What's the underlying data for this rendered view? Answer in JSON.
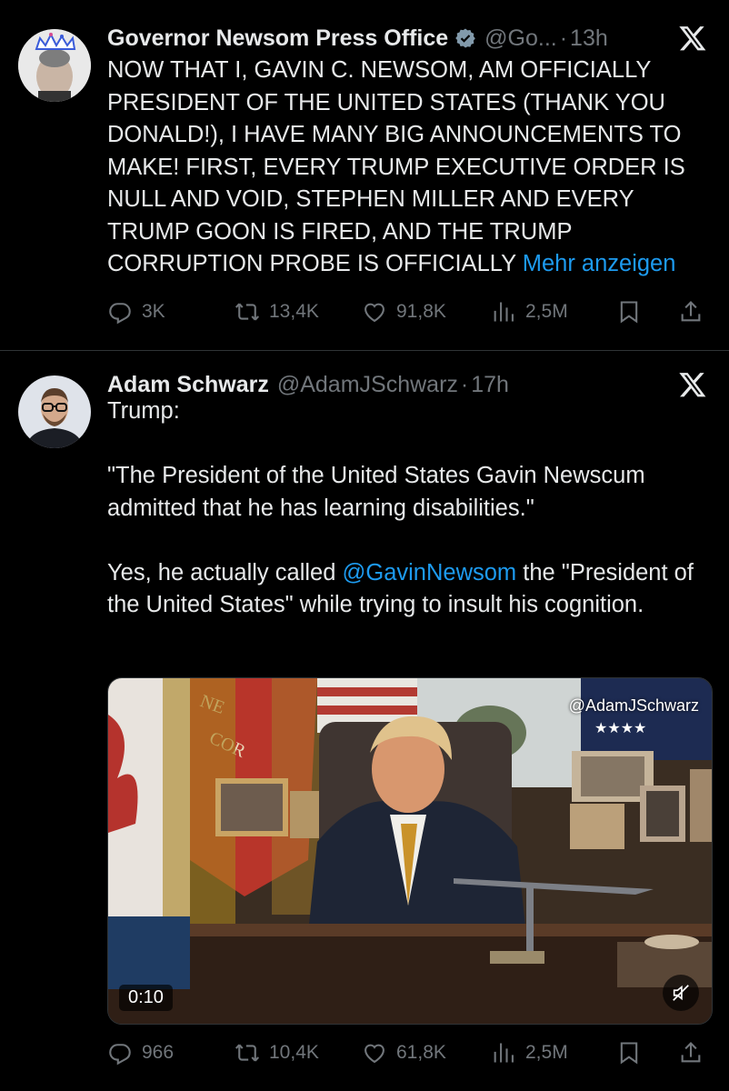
{
  "tweets": [
    {
      "author_name": "Governor Newsom Press Office",
      "verified": true,
      "handle": "@Go...",
      "separator": "·",
      "time": "13h",
      "text": "NOW THAT I, GAVIN C. NEWSOM, AM OFFICIALLY PRESIDENT OF THE UNITED STATES (THANK YOU DONALD!), I HAVE MANY BIG ANNOUNCEMENTS TO MAKE! FIRST, EVERY TRUMP EXECUTIVE ORDER IS NULL AND VOID, STEPHEN MILLER AND EVERY TRUMP GOON IS FIRED, AND THE TRUMP CORRUPTION PROBE IS OFFICIALLY ",
      "show_more": "Mehr anzeigen",
      "replies": "3K",
      "retweets": "13,4K",
      "likes": "91,8K",
      "views": "2,5M"
    },
    {
      "author_name": "Adam Schwarz",
      "verified": false,
      "handle": "@AdamJSchwarz",
      "separator": "·",
      "time": "17h",
      "text_part1": "Trump:\n\n\"The President of the United States Gavin Newscum admitted that he has learning disabilities.\"\n\nYes, he actually called ",
      "mention": "@GavinNewsom",
      "text_part2": " the \"President of the United States\" while trying to insult his cognition.",
      "video": {
        "watermark": "@AdamJSchwarz",
        "duration": "0:10",
        "muted": true
      },
      "replies": "966",
      "retweets": "10,4K",
      "likes": "61,8K",
      "views": "2,5M"
    }
  ],
  "colors": {
    "background": "#000000",
    "text": "#e7e9ea",
    "secondary": "#71767b",
    "link": "#1d9bf0",
    "verified": "#829aab"
  },
  "icons": [
    "reply-icon",
    "retweet-icon",
    "like-icon",
    "views-icon",
    "bookmark-icon",
    "share-icon",
    "x-logo-icon",
    "verified-badge-icon",
    "mute-icon"
  ]
}
